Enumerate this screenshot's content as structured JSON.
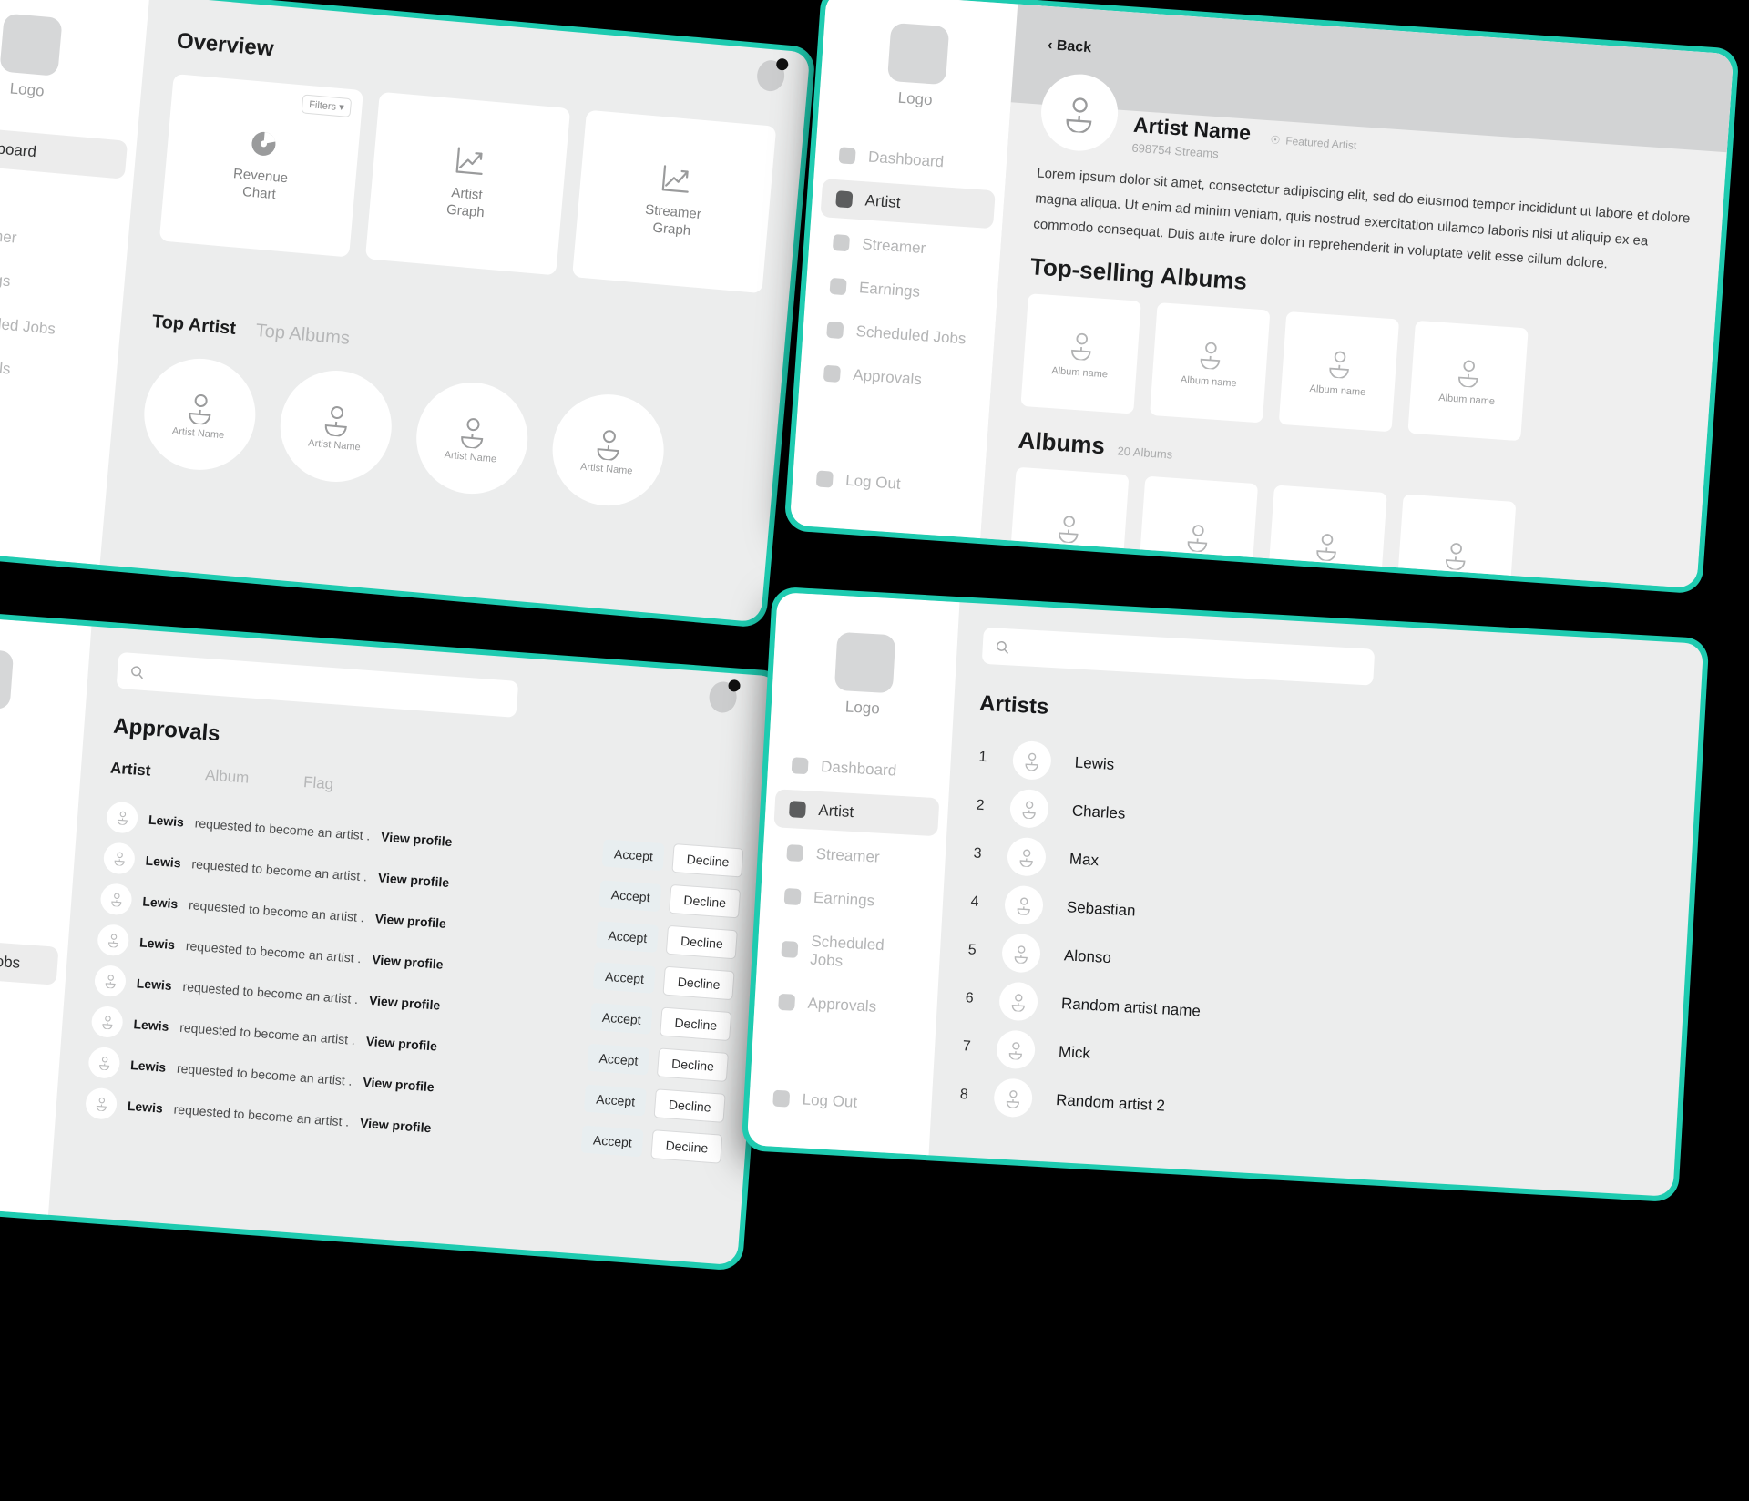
{
  "theme": {
    "accent": "#1ecbb0",
    "bg": "#000000",
    "panel_bg": "#eceded",
    "sidebar_bg": "#ffffff"
  },
  "sidebar": {
    "logo_label": "Logo",
    "items": [
      {
        "label": "Dashboard"
      },
      {
        "label": "Artist"
      },
      {
        "label": "Streamer"
      },
      {
        "label": "Earnings"
      },
      {
        "label": "Scheduled Jobs"
      },
      {
        "label": "Approvals"
      }
    ],
    "logout_label": "Log Out"
  },
  "dashboard": {
    "title": "Overview",
    "filters_label": "Filters",
    "cards": [
      {
        "label_line1": "Revenue",
        "label_line2": "Chart",
        "icon": "pie-chart-icon"
      },
      {
        "label_line1": "Artist",
        "label_line2": "Graph",
        "icon": "line-chart-icon"
      },
      {
        "label_line1": "Streamer",
        "label_line2": "Graph",
        "icon": "line-chart-icon"
      }
    ],
    "tabs": [
      {
        "label": "Top Artist",
        "active": true
      },
      {
        "label": "Top Albums",
        "active": false
      }
    ],
    "top_artists": [
      {
        "name": "Artist Name"
      },
      {
        "name": "Artist Name"
      },
      {
        "name": "Artist Name"
      },
      {
        "name": "Artist Name"
      }
    ]
  },
  "artist_detail": {
    "back_label": "Back",
    "name": "Artist Name",
    "streams": "698754 Streams",
    "featured_label": "Featured Artist",
    "bio": "Lorem ipsum dolor sit amet, consectetur adipiscing elit, sed do eiusmod tempor incididunt ut labore et dolore magna aliqua. Ut enim ad minim veniam, quis nostrud exercitation ullamco laboris nisi ut aliquip ex ea commodo consequat. Duis aute irure dolor in reprehenderit in voluptate velit esse cillum dolore.",
    "top_selling_title": "Top-selling Albums",
    "top_selling_albums": [
      {
        "name": "Album name"
      },
      {
        "name": "Album name"
      },
      {
        "name": "Album name"
      },
      {
        "name": "Album name"
      }
    ],
    "albums_title": "Albums",
    "albums_count": "20 Albums",
    "albums": [
      {
        "name": ""
      },
      {
        "name": ""
      },
      {
        "name": ""
      },
      {
        "name": ""
      }
    ]
  },
  "approvals": {
    "search_placeholder": "",
    "title": "Approvals",
    "tabs": [
      {
        "label": "Artist",
        "active": true
      },
      {
        "label": "Album",
        "active": false
      },
      {
        "label": "Flag",
        "active": false
      }
    ],
    "accept_label": "Accept",
    "decline_label": "Decline",
    "rows": [
      {
        "who": "Lewis",
        "what": "requested to become an artist .",
        "link": "View profile"
      },
      {
        "who": "Lewis",
        "what": "requested to become an artist .",
        "link": "View profile"
      },
      {
        "who": "Lewis",
        "what": "requested to become an artist .",
        "link": "View profile"
      },
      {
        "who": "Lewis",
        "what": "requested to become an artist .",
        "link": "View profile"
      },
      {
        "who": "Lewis",
        "what": "requested to become an artist .",
        "link": "View profile"
      },
      {
        "who": "Lewis",
        "what": "requested to become an artist .",
        "link": "View profile"
      },
      {
        "who": "Lewis",
        "what": "requested to become an artist .",
        "link": "View profile"
      },
      {
        "who": "Lewis",
        "what": "requested to become an artist .",
        "link": "View profile"
      }
    ]
  },
  "artists_list": {
    "search_placeholder": "",
    "title": "Artists",
    "rows": [
      {
        "rank": "1",
        "name": "Lewis"
      },
      {
        "rank": "2",
        "name": "Charles"
      },
      {
        "rank": "3",
        "name": "Max"
      },
      {
        "rank": "4",
        "name": "Sebastian"
      },
      {
        "rank": "5",
        "name": "Alonso"
      },
      {
        "rank": "6",
        "name": "Random artist name"
      },
      {
        "rank": "7",
        "name": "Mick"
      },
      {
        "rank": "8",
        "name": "Random artist 2"
      }
    ]
  }
}
